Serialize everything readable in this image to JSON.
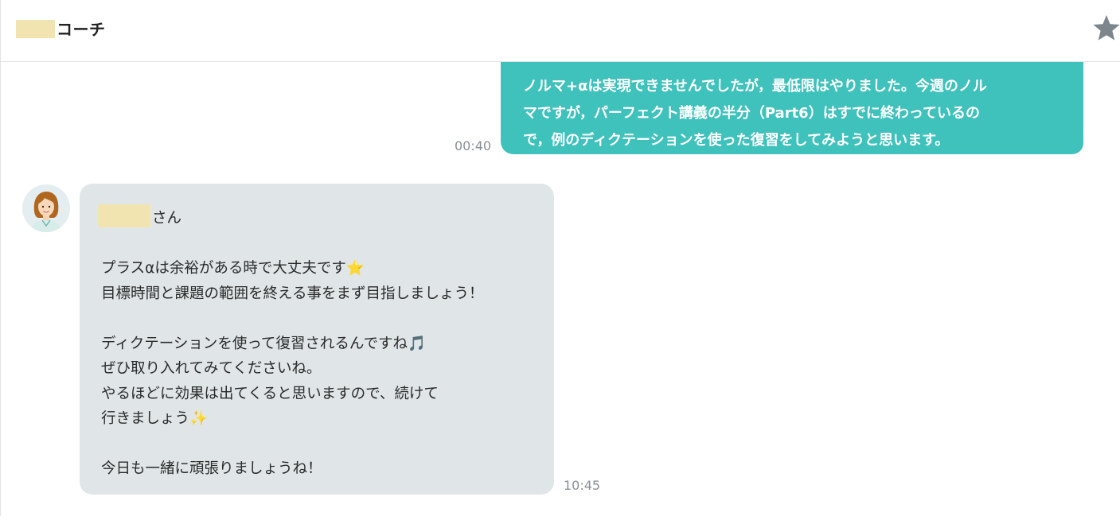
{
  "header": {
    "title": "コーチ"
  },
  "messages": {
    "outgoing": {
      "lines": [
        "ノルマ+αは実現できませんでしたが，最低限はやりました。今週のノル",
        "マですが，パーフェクト講義の半分（Part6）はすでに終わっているの",
        "で，例のディクテーションを使った復習をしてみようと思います。"
      ],
      "time": "00:40"
    },
    "incoming": {
      "greeting_suffix": "さん",
      "lines": [
        "",
        "プラスαは余裕がある時で大丈夫です⭐",
        "目標時間と課題の範囲を終える事をまず目指しましょう！",
        "",
        "ディクテーションを使って復習されるんですね🎵",
        "ぜひ取り入れてみてくださいね。",
        "やるほどに効果は出てくると思いますので、続けて",
        "行きましょう✨",
        "",
        "今日も一緒に頑張りましょうね！"
      ],
      "time": "10:45"
    }
  },
  "colors": {
    "outgoing_bubble": "#3fc1bc",
    "incoming_bubble": "#e0e6e8",
    "redaction": "#f2e4b1",
    "star": "#7d868c"
  },
  "icons": {
    "star": "star-icon",
    "avatar": "coach-avatar"
  }
}
